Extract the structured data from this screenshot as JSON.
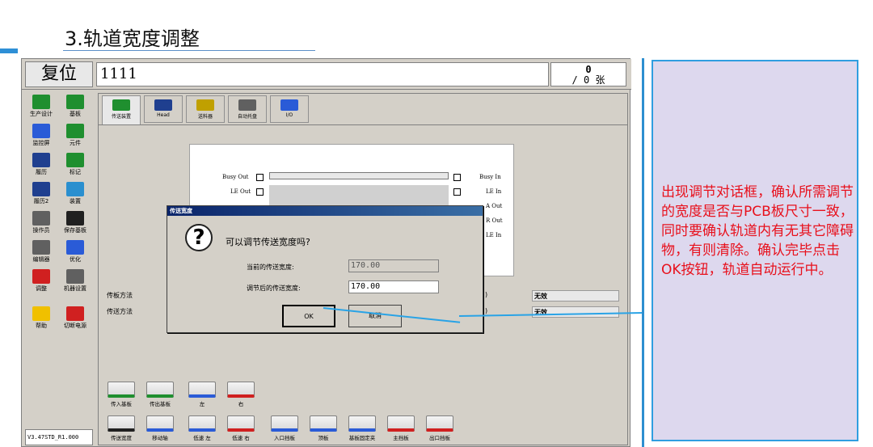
{
  "slide": {
    "title": "3.轨道宽度调整"
  },
  "header": {
    "reset_label": "复位",
    "job_name": "1111",
    "count_top": "0",
    "count_bottom": "/ 0 张"
  },
  "sidebar": {
    "items": [
      {
        "label": "生产设计",
        "icon": "production-design-icon",
        "color": "#1f8f2f"
      },
      {
        "label": "基板",
        "icon": "board-icon",
        "color": "#1f8f2f"
      },
      {
        "label": "监控屏",
        "icon": "monitor-icon",
        "color": "#2a5bd7"
      },
      {
        "label": "元件",
        "icon": "component-icon",
        "color": "#1f8f2f"
      },
      {
        "label": "履历",
        "icon": "history-icon",
        "color": "#1f3f8f"
      },
      {
        "label": "标记",
        "icon": "mark-icon",
        "color": "#1f8f2f"
      },
      {
        "label": "履历2",
        "icon": "history2-icon",
        "color": "#1f3f8f"
      },
      {
        "label": "装置",
        "icon": "device-icon",
        "color": "#2a8fcf"
      },
      {
        "label": "操作员",
        "icon": "operator-icon",
        "color": "#606060"
      },
      {
        "label": "保存基板",
        "icon": "save-icon",
        "color": "#202020"
      },
      {
        "label": "编辑器",
        "icon": "editor-icon",
        "color": "#606060"
      },
      {
        "label": "优化",
        "icon": "optimize-icon",
        "color": "#2a5bd7"
      },
      {
        "label": "调整",
        "icon": "adjust-icon",
        "color": "#d02020"
      },
      {
        "label": "机器设置",
        "icon": "machine-settings-icon",
        "color": "#606060"
      },
      {
        "label": "帮助",
        "icon": "help-icon",
        "color": "#f0c000"
      },
      {
        "label": "切断电源",
        "icon": "power-icon",
        "color": "#d02020"
      }
    ],
    "version": "V3.47STD_R1.000"
  },
  "tabs": [
    {
      "label": "传送装置",
      "icon": "conveyor-icon",
      "color": "#1f8f2f"
    },
    {
      "label": "Head",
      "icon": "head-icon",
      "color": "#1f3f8f"
    },
    {
      "label": "送料器",
      "icon": "feeder-icon",
      "color": "#c0a000"
    },
    {
      "label": "自动托盘",
      "icon": "tray-icon",
      "color": "#606060"
    },
    {
      "label": "I/O",
      "icon": "io-icon",
      "color": "#2a5bd7"
    }
  ],
  "signals": {
    "busy_out": "Busy Out",
    "le_out": "LE Out",
    "busy_in": "Busy In",
    "le_in": "LE In",
    "a_out": "A Out",
    "r_out": "R Out",
    "le_in2": "LE In"
  },
  "fields": {
    "transfer_method_label": "传板方法",
    "transfer_method_suffix": ")",
    "transfer_method_value": "无效",
    "send_method_label": "传送方法",
    "send_method_suffix": ")",
    "send_method_value": "无效"
  },
  "bottom": {
    "row1": [
      {
        "label": "传入基板",
        "icon": "board-in-icon",
        "color": "#1f8f2f"
      },
      {
        "label": "传出基板",
        "icon": "board-out-icon",
        "color": "#1f8f2f"
      },
      {
        "label": "左",
        "icon": "left-arrow-icon",
        "color": "#2a5bd7"
      },
      {
        "label": "右",
        "icon": "right-arrow-icon",
        "color": "#d02020"
      }
    ],
    "row2": [
      {
        "label": "传送宽度",
        "icon": "width-icon",
        "color": "#202020"
      },
      {
        "label": "移动轴",
        "icon": "move-axis-icon",
        "color": "#2a5bd7"
      },
      {
        "label": "低速 左",
        "icon": "slow-left-icon",
        "color": "#2a5bd7"
      },
      {
        "label": "低速 右",
        "icon": "slow-right-icon",
        "color": "#d02020"
      },
      {
        "label": "入口挡板",
        "icon": "entry-stopper-icon",
        "color": "#2a5bd7"
      },
      {
        "label": "顶板",
        "icon": "top-plate-icon",
        "color": "#2a5bd7"
      },
      {
        "label": "基板固定夹",
        "icon": "board-clamp-icon",
        "color": "#2a5bd7"
      },
      {
        "label": "主挡板",
        "icon": "main-stopper-icon",
        "color": "#d02020"
      },
      {
        "label": "出口挡板",
        "icon": "exit-stopper-icon",
        "color": "#d02020"
      }
    ]
  },
  "dialog": {
    "title": "传送宽度",
    "question": "可以调节传送宽度吗?",
    "current_label": "当前的传送宽度:",
    "current_value": "170.00",
    "after_label": "调节后的传送宽度:",
    "after_value": "170.00",
    "ok_label": "OK",
    "cancel_label": "取消"
  },
  "note": {
    "text": "出现调节对话框，确认所需调节的宽度是否与PCB板尺寸一致，同时要确认轨道内有无其它障碍物，有则清除。确认完毕点击OK按钮，轨道自动运行中。"
  },
  "colors": {
    "accent": "#2d8fd0",
    "note_bg": "#ddd8ee",
    "note_text": "#e8101c"
  }
}
